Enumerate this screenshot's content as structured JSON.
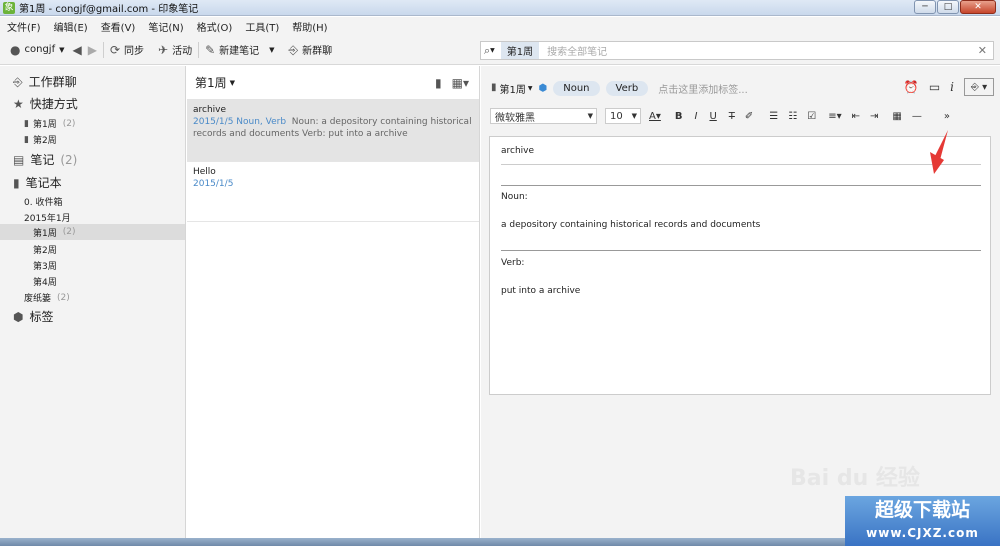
{
  "window": {
    "title": "第1周 - congjf@gmail.com - 印象笔记",
    "min": "─",
    "max": "□",
    "close": "✕"
  },
  "menu": [
    "文件(F)",
    "编辑(E)",
    "查看(V)",
    "笔记(N)",
    "格式(O)",
    "工具(T)",
    "帮助(H)"
  ],
  "toolbar": {
    "user": "congjf",
    "sync": "同步",
    "activity": "活动",
    "new_note": "新建笔记",
    "new_chat": "新群聊"
  },
  "search": {
    "scope": "第1周",
    "placeholder": "搜索全部笔记"
  },
  "sidebar": {
    "work_chat": "工作群聊",
    "shortcuts": "快捷方式",
    "shortcut_items": [
      {
        "label": "第1周",
        "count": "(2)"
      },
      {
        "label": "第2周"
      }
    ],
    "notes": "笔记",
    "notes_count": "(2)",
    "notebooks": "笔记本",
    "inbox": "0. 收件箱",
    "stack": "2015年1月",
    "weeks": [
      {
        "label": "第1周",
        "count": "(2)"
      },
      {
        "label": "第2周"
      },
      {
        "label": "第3周"
      },
      {
        "label": "第4周"
      }
    ],
    "trash": "废纸篓",
    "trash_count": "(2)",
    "tags": "标签"
  },
  "notelist": {
    "header": "第1周",
    "notes": [
      {
        "title": "archive",
        "meta": "2015/1/5  Noun, Verb",
        "snippet_1": "Noun: a depository containing historical",
        "snippet_2": "records and documents Verb: put into a archive"
      },
      {
        "title": "Hello",
        "meta": "2015/1/5"
      }
    ]
  },
  "editor": {
    "notebook": "第1周",
    "tags": [
      "Noun",
      "Verb"
    ],
    "tag_placeholder": "点击这里添加标签...",
    "font": "微软雅黑",
    "size": "10",
    "note": {
      "title": "archive",
      "h1": "Noun:",
      "t1": "a depository containing historical records and documents",
      "h2": "Verb:",
      "t2": "put into a archive"
    }
  },
  "watermark": {
    "line1": "超级下载站",
    "line2": "www.CJXZ.com"
  },
  "colors": {
    "accent": "#4a8ac8",
    "arrow": "#e53935",
    "selection": "#e4e4e4"
  }
}
